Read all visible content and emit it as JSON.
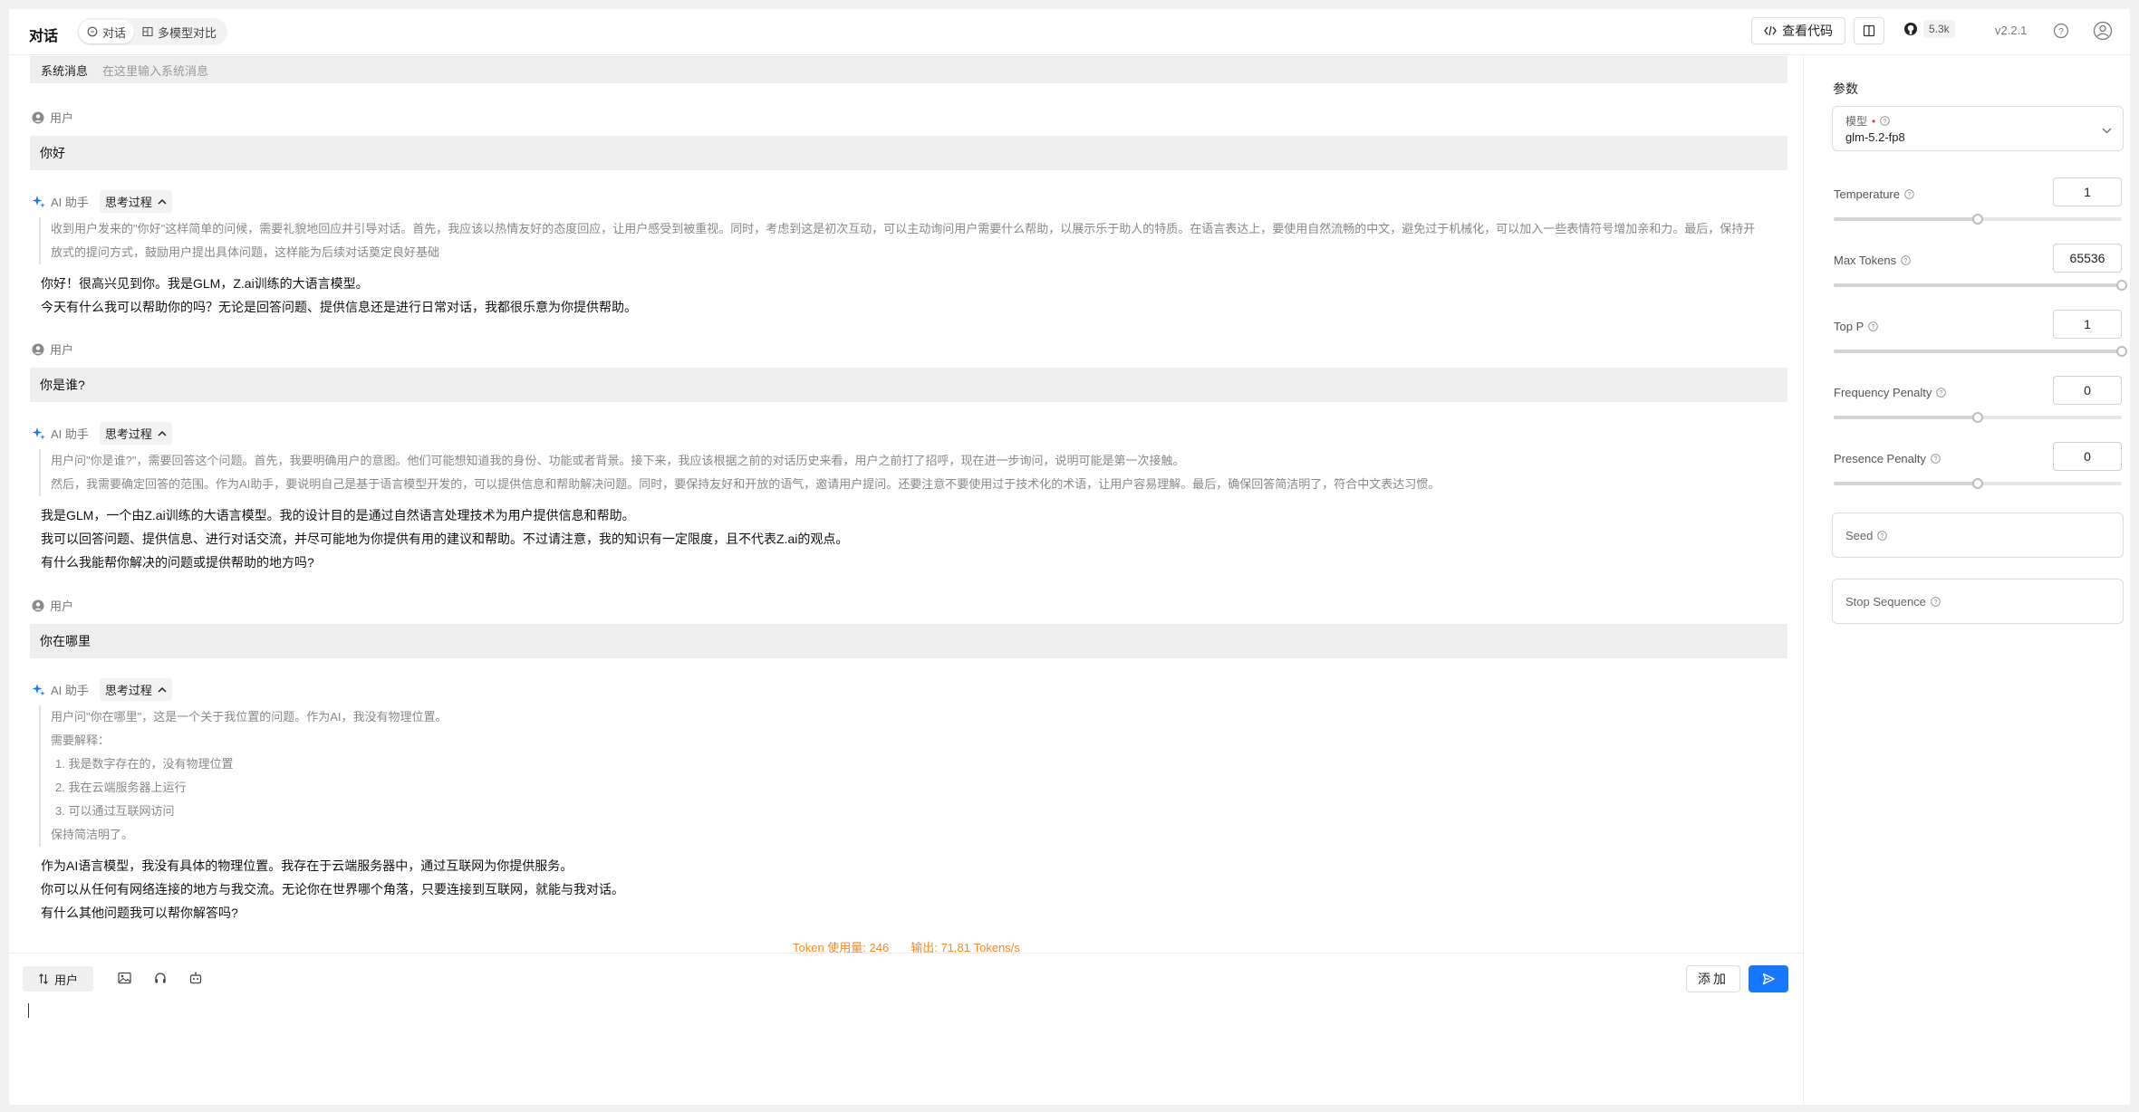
{
  "header": {
    "title": "对话",
    "tabs": [
      {
        "label": "对话",
        "icon": "chat-icon",
        "active": true
      },
      {
        "label": "多模型对比",
        "icon": "compare-icon",
        "active": false
      }
    ],
    "code_button": "查看代码",
    "github_stars": "5.3k",
    "version": "v2.2.1"
  },
  "system": {
    "label": "系统消息",
    "placeholder": "在这里输入系统消息"
  },
  "messages": [
    {
      "role": "user",
      "role_label": "用户",
      "text": "你好"
    },
    {
      "role": "assistant",
      "role_label": "AI 助手",
      "think_label": "思考过程",
      "think": [
        "收到用户发来的\"你好\"这样简单的问候，需要礼貌地回应并引导对话。首先，我应该以热情友好的态度回应，让用户感受到被重视。同时，考虑到这是初次互动，可以主动询问用户需要什么帮助，以展示乐于助人的特质。在语言表达上，要使用自然流畅的中文，避免过于机械化，可以加入一些表情符号增加亲和力。最后，保持开",
        "放式的提问方式，鼓励用户提出具体问题，这样能为后续对话奠定良好基础"
      ],
      "answer": [
        "你好！很高兴见到你。我是GLM，Z.ai训练的大语言模型。",
        "今天有什么我可以帮助你的吗？无论是回答问题、提供信息还是进行日常对话，我都很乐意为你提供帮助。"
      ]
    },
    {
      "role": "user",
      "role_label": "用户",
      "text": "你是谁?"
    },
    {
      "role": "assistant",
      "role_label": "AI 助手",
      "think_label": "思考过程",
      "think": [
        "用户问\"你是谁?\"，需要回答这个问题。首先，我要明确用户的意图。他们可能想知道我的身份、功能或者背景。接下来，我应该根据之前的对话历史来看，用户之前打了招呼，现在进一步询问，说明可能是第一次接触。",
        "然后，我需要确定回答的范围。作为AI助手，要说明自己是基于语言模型开发的，可以提供信息和帮助解决问题。同时，要保持友好和开放的语气，邀请用户提问。还要注意不要使用过于技术化的术语，让用户容易理解。最后，确保回答简洁明了，符合中文表达习惯。"
      ],
      "answer": [
        "我是GLM，一个由Z.ai训练的大语言模型。我的设计目的是通过自然语言处理技术为用户提供信息和帮助。",
        "我可以回答问题、提供信息、进行对话交流，并尽可能地为你提供有用的建议和帮助。不过请注意，我的知识有一定限度，且不代表Z.ai的观点。",
        "有什么我能帮你解决的问题或提供帮助的地方吗?"
      ]
    },
    {
      "role": "user",
      "role_label": "用户",
      "text": "你在哪里"
    },
    {
      "role": "assistant",
      "role_label": "AI 助手",
      "think_label": "思考过程",
      "think": [
        "用户问\"你在哪里\"，这是一个关于我位置的问题。作为AI，我没有物理位置。",
        "需要解释：",
        "1. 我是数字存在的，没有物理位置",
        "2. 我在云端服务器上运行",
        "3. 可以通过互联网访问",
        "保持简洁明了。"
      ],
      "answer": [
        "作为AI语言模型，我没有具体的物理位置。我存在于云端服务器中，通过互联网为你提供服务。",
        "你可以从任何有网络连接的地方与我交流。无论你在世界哪个角落，只要连接到互联网，就能与我对话。",
        "有什么其他问题我可以帮你解答吗?"
      ]
    }
  ],
  "stats": {
    "token_usage": "Token 使用量: 246",
    "output_speed": "输出: 71.81 Tokens/s"
  },
  "input": {
    "role_button": "用户",
    "add_button": "添加",
    "value": ""
  },
  "params": {
    "title": "参数",
    "model": {
      "label": "模型",
      "value": "glm-5.2-fp8"
    },
    "temperature": {
      "label": "Temperature",
      "value": "1",
      "slider_fraction": 0.5
    },
    "max_tokens": {
      "label": "Max Tokens",
      "value": "65536",
      "slider_fraction": 1.0
    },
    "top_p": {
      "label": "Top P",
      "value": "1",
      "slider_fraction": 1.0
    },
    "frequency_penalty": {
      "label": "Frequency Penalty",
      "value": "0",
      "slider_fraction": 0.5
    },
    "presence_penalty": {
      "label": "Presence Penalty",
      "value": "0",
      "slider_fraction": 0.5
    },
    "seed": {
      "label": "Seed"
    },
    "stop_sequence": {
      "label": "Stop Sequence"
    }
  },
  "colors": {
    "accent": "#1677ff",
    "stats": "#f08a24",
    "user_bubble": "#eeeeee"
  }
}
